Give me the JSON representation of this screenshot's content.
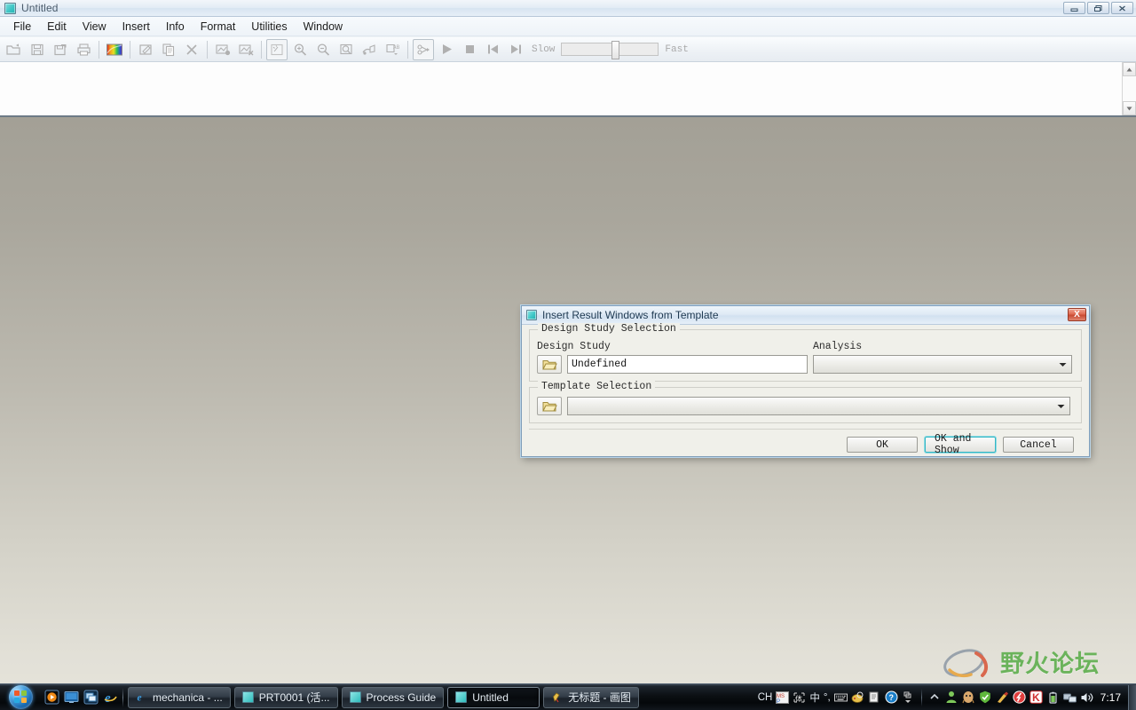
{
  "window": {
    "title": "Untitled",
    "icon": "creo-window-icon",
    "controls": [
      {
        "name": "minimize",
        "glyph": "minimize-icon"
      },
      {
        "name": "restore",
        "glyph": "restore-icon"
      },
      {
        "name": "close",
        "glyph": "close-icon"
      }
    ]
  },
  "menubar": {
    "items": [
      {
        "label": "File"
      },
      {
        "label": "Edit"
      },
      {
        "label": "View"
      },
      {
        "label": "Insert"
      },
      {
        "label": "Info"
      },
      {
        "label": "Format"
      },
      {
        "label": "Utilities"
      },
      {
        "label": "Window"
      }
    ]
  },
  "toolbar": {
    "groups": [
      {
        "buttons": [
          {
            "name": "open-file-icon",
            "title": "Open"
          },
          {
            "name": "save-icon",
            "title": "Save"
          },
          {
            "name": "save-as-icon",
            "title": "Save As"
          },
          {
            "name": "print-icon",
            "title": "Print"
          }
        ]
      },
      {
        "buttons": [
          {
            "name": "color-spectrum-icon",
            "title": "Color"
          }
        ]
      },
      {
        "buttons": [
          {
            "name": "edit-window-icon",
            "title": "Edit"
          },
          {
            "name": "copy-icon",
            "title": "Copy"
          },
          {
            "name": "delete-x-icon",
            "title": "Delete"
          }
        ]
      },
      {
        "buttons": [
          {
            "name": "result-window-add-icon",
            "title": "Insert Result Window"
          },
          {
            "name": "result-window-remove-icon",
            "title": "Remove Result Window"
          }
        ]
      },
      {
        "buttons": [
          {
            "name": "dynamic-query-icon",
            "title": "Query"
          },
          {
            "name": "zoom-in-icon",
            "title": "Zoom In"
          },
          {
            "name": "zoom-out-icon",
            "title": "Zoom Out"
          },
          {
            "name": "zoom-area-icon",
            "title": "Zoom Area"
          },
          {
            "name": "paint-model-icon",
            "title": "Display"
          },
          {
            "name": "annotate-ab-icon",
            "title": "Annotate"
          }
        ]
      },
      {
        "buttons": [
          {
            "name": "animate-icon",
            "title": "Animate",
            "boxed": true
          }
        ]
      },
      {
        "buttons": [
          {
            "name": "play-icon",
            "title": "Play"
          },
          {
            "name": "stop-icon",
            "title": "Stop"
          },
          {
            "name": "first-frame-icon",
            "title": "First Frame"
          },
          {
            "name": "next-frame-icon",
            "title": "Next Frame"
          }
        ]
      }
    ],
    "speed": {
      "slow_label": "Slow",
      "fast_label": "Fast",
      "value_percent": 52
    }
  },
  "dialog": {
    "title": "Insert Result Windows from Template",
    "icon": "creo-dialog-icon",
    "close_glyph": "X",
    "groups": {
      "design_study": {
        "legend": "Design Study Selection",
        "design_study_label": "Design Study",
        "design_study_value": "Undefined",
        "design_study_browse_icon": "folder-open-icon",
        "analysis_label": "Analysis",
        "analysis_value": "",
        "analysis_dropdown_icon": "chevron-down-icon"
      },
      "template": {
        "legend": "Template Selection",
        "template_browse_icon": "folder-open-icon",
        "template_value": "",
        "template_dropdown_icon": "chevron-down-icon"
      }
    },
    "buttons": [
      {
        "label": "OK",
        "name": "ok-button",
        "focused": false
      },
      {
        "label": "OK and Show",
        "name": "ok-and-show-button",
        "focused": true
      },
      {
        "label": "Cancel",
        "name": "cancel-button",
        "focused": false
      }
    ]
  },
  "watermark": {
    "text": "野火论坛",
    "color": "#5bad4a"
  },
  "taskbar": {
    "start_button": "start-orb",
    "quick_launch": [
      {
        "name": "media-player-icon"
      },
      {
        "name": "show-desktop-icon"
      },
      {
        "name": "switch-windows-icon"
      },
      {
        "name": "internet-explorer-icon"
      }
    ],
    "tasks": [
      {
        "label": "mechanica - ...",
        "icon": "internet-explorer-icon",
        "active": false
      },
      {
        "label": "PRT0001 (活...",
        "icon": "creo-icon",
        "active": false
      },
      {
        "label": "Process Guide",
        "icon": "creo-icon",
        "active": false
      },
      {
        "label": "Untitled",
        "icon": "creo-icon",
        "active": true
      },
      {
        "label": "无标题 - 画图",
        "icon": "paint-icon",
        "active": false
      }
    ],
    "ime": {
      "language": "CH",
      "mode_label": "中",
      "punctuation_label": "°,",
      "items": [
        {
          "name": "ime-msp-icon"
        },
        {
          "name": "ime-handwriting-icon"
        },
        {
          "name": "ime-chinese-mode-icon"
        },
        {
          "name": "ime-punctuation-icon"
        },
        {
          "name": "ime-soft-keyboard-icon"
        },
        {
          "name": "ime-palette-icon"
        },
        {
          "name": "ime-properties-icon"
        },
        {
          "name": "ime-help-icon"
        }
      ]
    },
    "tray": [
      {
        "name": "show-hidden-icons-icon"
      },
      {
        "name": "user-account-icon"
      },
      {
        "name": "qq-icon"
      },
      {
        "name": "security-shield-icon"
      },
      {
        "name": "cleanup-icon"
      },
      {
        "name": "antivirus-red-icon"
      },
      {
        "name": "kingsoft-icon"
      },
      {
        "name": "battery-icon"
      },
      {
        "name": "network-icon"
      },
      {
        "name": "volume-icon"
      }
    ],
    "clock": "7:17"
  }
}
